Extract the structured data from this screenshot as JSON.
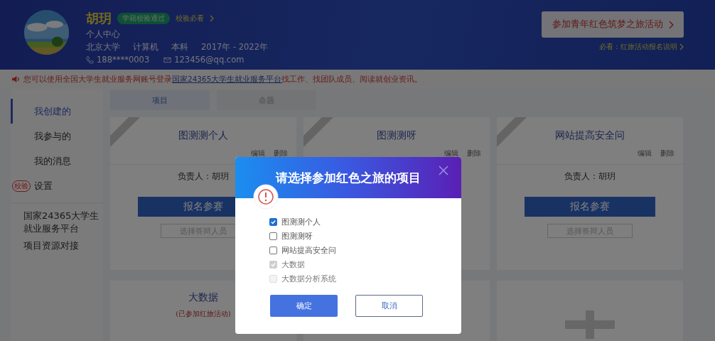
{
  "header": {
    "name": "胡玥",
    "badge": "学籍校验通过",
    "badge_link": "校验必看",
    "subtitle": "个人中心",
    "facts": [
      "北京大学",
      "计算机",
      "本科",
      "2017年 - 2022年"
    ],
    "phone": "188****0003",
    "email": "123456@qq.com",
    "action_button": "参加青年红色筑梦之旅活动",
    "action_note": "必看：红旅活动报名说明"
  },
  "notice": {
    "text_before": "您可以使用全国大学生就业服务网账号登录",
    "link": "国家24365大学生就业服务平台",
    "text_after": "找工作、找团队成员、阅读就创业资讯。"
  },
  "sidebar": {
    "items": [
      {
        "label": "我创建的",
        "selected": true
      },
      {
        "label": "我参与的",
        "selected": false
      },
      {
        "label": "我的消息",
        "selected": false
      },
      {
        "label": "设置",
        "selected": false,
        "stamp": "校验"
      }
    ],
    "links": [
      "国家24365大学生就业服务平台",
      "项目资源对接"
    ]
  },
  "tabs": [
    {
      "label": "项目",
      "selected": true
    },
    {
      "label": "命题",
      "selected": false
    }
  ],
  "cards": [
    {
      "kind": "project",
      "ribbon": true,
      "title": "图测测个人",
      "actions": [
        "编辑",
        "删除"
      ],
      "leader": "负责人：胡玥",
      "signup_button": "报名参赛",
      "judges": {
        "placeholder": "选择答辩人员"
      }
    },
    {
      "kind": "project",
      "ribbon": true,
      "title": "图测测呀",
      "actions": [
        "编辑",
        "删除"
      ]
    },
    {
      "kind": "project",
      "ribbon": true,
      "title": "网站提高安全问",
      "actions": [
        "编辑",
        "删除"
      ],
      "leader": "负责人：胡玥",
      "signup_button": "报名参赛",
      "judges": {
        "placeholder": "选择答辩人员"
      }
    },
    {
      "kind": "joined",
      "ribbon": false,
      "title": "大数据",
      "status": "(已参加红旅活动)"
    },
    {
      "kind": "blank",
      "ribbon": false
    },
    {
      "kind": "add",
      "ribbon": false
    }
  ],
  "dialog": {
    "title": "请选择参加红色之旅的项目",
    "items": [
      {
        "label": "图测测个人",
        "checked": true,
        "disabled": false
      },
      {
        "label": "图测测呀",
        "checked": false,
        "disabled": false
      },
      {
        "label": "网站提高安全问",
        "checked": false,
        "disabled": false
      },
      {
        "label": "大数据",
        "checked": true,
        "disabled": true
      },
      {
        "label": "大数据分析系统",
        "checked": false,
        "disabled": true
      }
    ],
    "confirm": "确定",
    "cancel": "取消"
  }
}
